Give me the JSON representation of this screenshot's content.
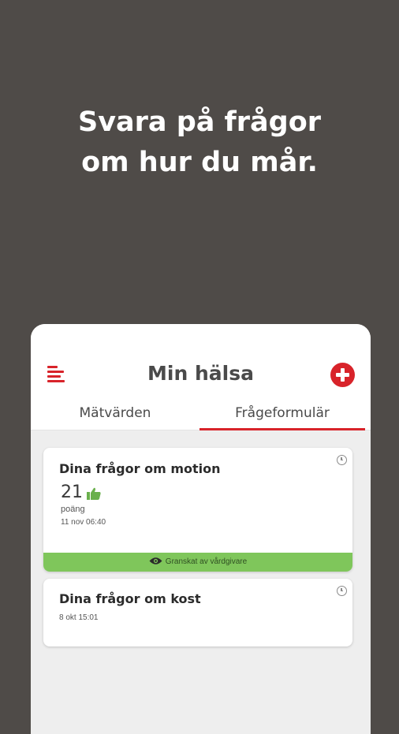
{
  "hero": {
    "line1": "Svara på frågor",
    "line2": "om hur du mår."
  },
  "appbar": {
    "title": "Min hälsa",
    "menu_icon": "menu-icon",
    "add_icon": "add-circle-icon"
  },
  "tabs": [
    {
      "label": "Mätvärden",
      "selected": false
    },
    {
      "label": "Frågeformulär",
      "selected": true
    }
  ],
  "colors": {
    "brand_red": "#d8232a",
    "reviewed_green": "#7fc65b",
    "background": "#4f4b48"
  },
  "cards": [
    {
      "title": "Dina frågor om motion",
      "score": "21",
      "score_icon": "thumbs-up-icon",
      "score_label": "poäng",
      "timestamp": "11 nov 06:40",
      "status_icon": "eye-icon",
      "status": "Granskat av vårdgivare"
    },
    {
      "title": "Dina frågor om kost",
      "timestamp": "8 okt 15:01"
    }
  ]
}
